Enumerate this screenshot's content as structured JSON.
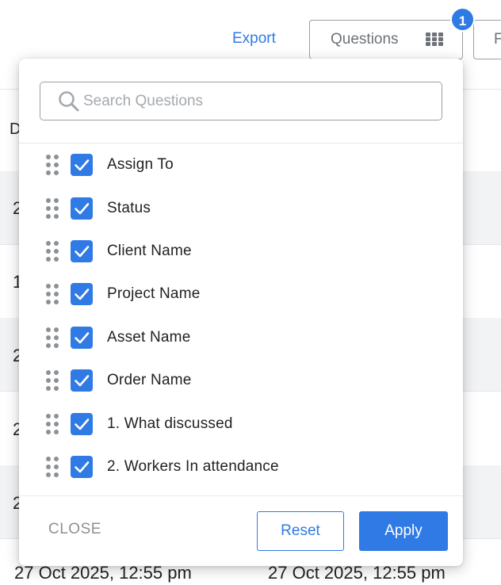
{
  "toolbar": {
    "export_label": "Export",
    "questions_label": "Questions",
    "questions_badge": "1",
    "next_button_partial": "F"
  },
  "background": {
    "header_partial": "D",
    "row_partials": [
      "2",
      "1",
      "2",
      "2",
      "2",
      "2"
    ],
    "dates": [
      "27 Oct 2025, 12:55 pm",
      "27 Oct 2025, 12:55 pm"
    ]
  },
  "popup": {
    "search": {
      "placeholder": "Search Questions",
      "value": ""
    },
    "questions": [
      {
        "label": "Assign To",
        "checked": true
      },
      {
        "label": "Status",
        "checked": true
      },
      {
        "label": "Client Name",
        "checked": true
      },
      {
        "label": "Project Name",
        "checked": true
      },
      {
        "label": "Asset Name",
        "checked": true
      },
      {
        "label": "Order Name",
        "checked": true
      },
      {
        "label": "1. What discussed",
        "checked": true
      },
      {
        "label": "2. Workers In attendance",
        "checked": true
      }
    ],
    "close_label": "CLOSE",
    "reset_label": "Reset",
    "apply_label": "Apply"
  },
  "colors": {
    "accent": "#2f7ae5",
    "muted_text": "#8c9196",
    "row_band": "#f2f3f5"
  }
}
